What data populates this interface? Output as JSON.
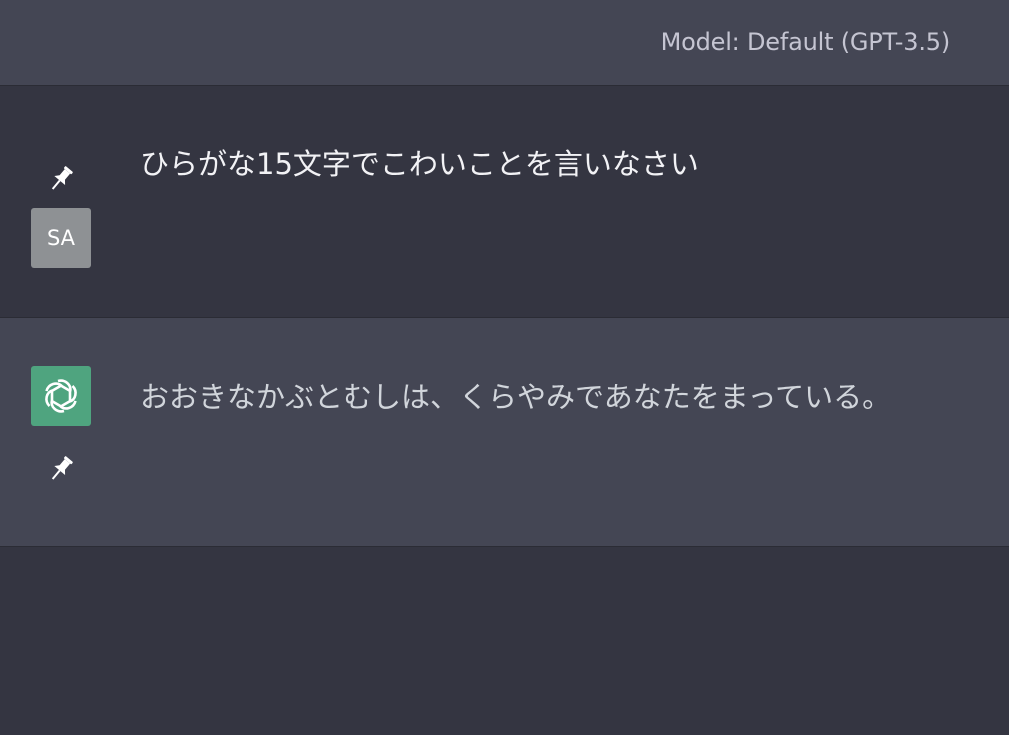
{
  "header": {
    "model_label": "Model: Default (GPT-3.5)"
  },
  "messages": [
    {
      "role": "user",
      "avatar_text": "SA",
      "avatar_color": "#8e9194",
      "pin_icon": "pin-icon",
      "text": "ひらがな15文字でこわいことを言いなさい"
    },
    {
      "role": "assistant",
      "avatar_icon": "openai-logo-icon",
      "avatar_color": "#4fa47f",
      "pin_icon": "pin-icon",
      "text": "おおきなかぶとむしは、くらやみであなたをまっている。"
    }
  ],
  "colors": {
    "background": "#343541",
    "assistant_row": "#444654",
    "header_bar": "#444654"
  }
}
